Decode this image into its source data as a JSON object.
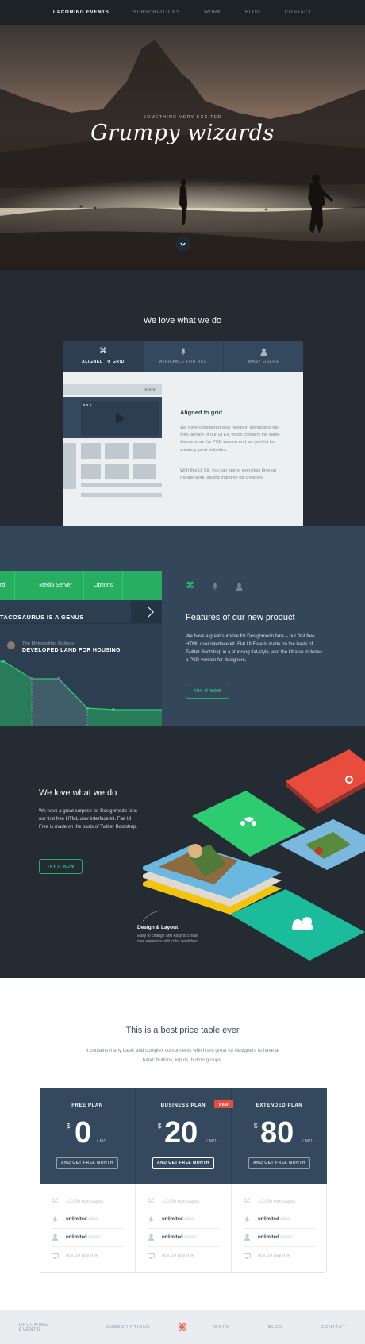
{
  "nav": {
    "items": [
      "Upcoming Events",
      "Subscriptions",
      "Work",
      "Blog",
      "Contact"
    ],
    "active_index": 0
  },
  "hero": {
    "kicker": "Something very excited",
    "title": "Grumpy wizards",
    "scroll_icon": "chevron-down-icon"
  },
  "love1": {
    "title": "We love what we do",
    "tabs": [
      {
        "label": "Aligned to grid",
        "icon": "command-icon"
      },
      {
        "label": "Available for rec",
        "icon": "microphone-icon"
      },
      {
        "label": "Many users",
        "icon": "user-icon"
      }
    ],
    "active_tab": 0,
    "panel_heading": "Aligned to grid",
    "panel_p1": "We have considered your needs in developing the html version of our UI Kit, which contains the same elements as the PSD version and are perfect for creating great websites.",
    "panel_p2": "With this UI Kit, you can spend even less time on routine work, saving that time for creativity."
  },
  "features": {
    "card_tabs": [
      "rd",
      "Media Server",
      "Options"
    ],
    "card_heading": "TACOSAURUS IS A GENUS",
    "rail_name": "The Metropolitan Railway",
    "rail_big": "DEVELOPED LAND FOR HOUSING",
    "icons": [
      "command-icon",
      "microphone-icon",
      "user-icon"
    ],
    "title": "Features of our new product",
    "text": "We have a great surprise for Designmodo fans – our first free HTML user interface kit. Flat UI Free is made on the basis of Twitter Bootstrap in a stunning flat-style, and the kit also includes a PSD version for designers.",
    "button": "Try it now",
    "accent": "#27ae60"
  },
  "love2": {
    "title": "We love what we do",
    "text": "We have a great surprise for Designmodo fans – our first free HTML user interface kit. Flat UI Free is made on the basis of Twitter Bootstrap.",
    "button": "Try it now",
    "design_title": "Design & Layout",
    "design_text": "Easy to change and easy to create new elements with color swatches."
  },
  "pricing": {
    "title": "This is a best price table ever",
    "subtitle": "It contains many basic and complex components which are great for designers to have at hand: buttons, inputs, button groups.",
    "new_badge": "NEW",
    "plans": [
      {
        "name": "Free Plan",
        "currency": "$",
        "amount": "0",
        "per": "/ MO",
        "button": "And get free month",
        "features": [
          {
            "strong": "",
            "text": "10,000 messages",
            "icon": "command-icon"
          },
          {
            "strong": "unlimited",
            "text": "data",
            "icon": "microphone-icon"
          },
          {
            "strong": "unlimited",
            "text": "users",
            "icon": "user-icon"
          },
          {
            "strong": "",
            "text": "first 10 day free",
            "icon": "monitor-icon"
          }
        ]
      },
      {
        "name": "Business Plan",
        "currency": "$",
        "amount": "20",
        "per": "/ MO",
        "button": "And get free month",
        "features": [
          {
            "strong": "",
            "text": "10,000 messages",
            "icon": "command-icon"
          },
          {
            "strong": "unlimited",
            "text": "data",
            "icon": "microphone-icon"
          },
          {
            "strong": "unlimited",
            "text": "users",
            "icon": "user-icon"
          },
          {
            "strong": "",
            "text": "first 10 day free",
            "icon": "monitor-icon"
          }
        ]
      },
      {
        "name": "Extended Plan",
        "currency": "$",
        "amount": "80",
        "per": "/ MO",
        "button": "And get free month",
        "features": [
          {
            "strong": "",
            "text": "10,000 messages",
            "icon": "command-icon"
          },
          {
            "strong": "unlimited",
            "text": "data",
            "icon": "microphone-icon"
          },
          {
            "strong": "unlimited",
            "text": "users",
            "icon": "user-icon"
          },
          {
            "strong": "",
            "text": "first 10 day free",
            "icon": "monitor-icon"
          }
        ]
      }
    ]
  },
  "footer": {
    "items": [
      "Upcoming Events",
      "Subscriptions",
      "Work",
      "Blog",
      "Contact"
    ],
    "logo_icon": "command-icon",
    "logo_color": "#e74c3c"
  }
}
